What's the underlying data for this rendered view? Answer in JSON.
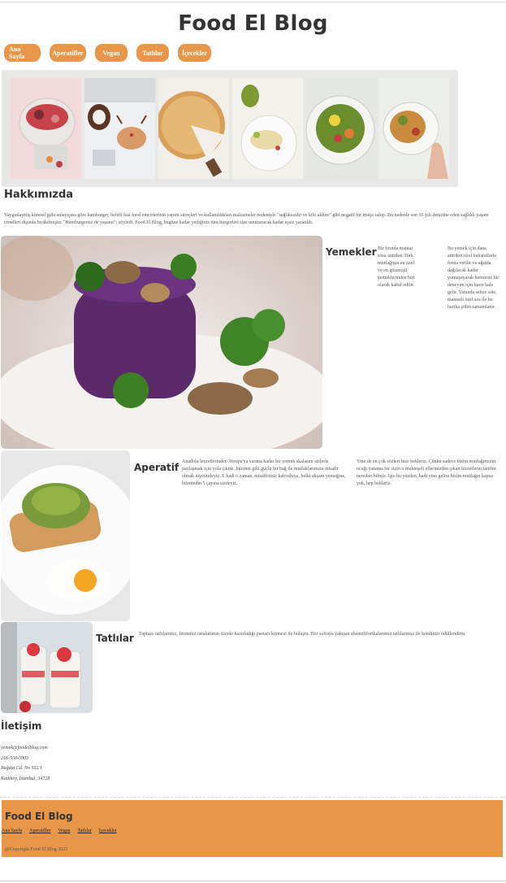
{
  "site_title": "Food El Blog",
  "nav": [
    "Ana Sayfa",
    "Aperatifler",
    "Vegan",
    "Tatlılar",
    "İçecekler"
  ],
  "about": {
    "title": "Hakkımızda",
    "text": "Yaygınlaşmış küresel gıda anlayışına göre hamburger, belirli fast food zincirlerinin yapım süreçleri ve kullanıldıkları malzemeler nedeniyle \"sağlıksızdır ve kilo aldırır\" gibi negatif bir imaja sahip. Bu nedenle son 10 yılı denizine eden sağlıklı yaşam trendleri dışında bırakılmıştır. \"Hamburgersiz de yaşanır\"; söyledi. Food El Blog, bugüne kadar yediğiniz tüm burgerleri size unutturacak kadar eşsiz yaratıldı."
  },
  "sections": [
    {
      "title": "Yemekler",
      "col1": "Bir fırında mantar sosu antrikot Türk mutfağının en özel ve en gösterişli yemeklerinden biri olarak kabul edilir.",
      "col2": "Bu yemek için dana antrikot özel baharatlarla fırına verilir ve ağızda dağılacak kadar yumuşayarak hemresiz bir deneyim için hazır hale gelir. Yanında sebze sote, mantarlı özel sos ile bu harika şölen tamamlanır."
    },
    {
      "title": "Aperatif",
      "col1": "Anadolu lezzetlerinden Avrupa'ya varana kadar bir yemek skalasını sizlerle paylaşmak için yola çıktık. İnternet gibi güçlü bir bağ ile mutfaklarımıza misafir olmak niyetindeyiz. E hadi o zaman, misafirimiz kahvaltıya, belki akşam yemeğine, bilemedin 5 çayına sizdeyiz.",
      "col2": "Yine de en çok sözleri bize bekleriz. Çünkü sadece bizim mutfağımızın ocağı yanarsa bir sizin o muhteşeli ellerinizden çıkan lezzetlerin tarifini nereden bilmiz. İşte bu yüzden, hadi yine gelirz bizim mutfağın kapısı yok, hep bekleriz."
    },
    {
      "title": "Tatlılar",
      "col1": "Taptaze tatlılarımız, fırınımız ustalarımın özenle hazırladığı pastacı kremesi ile buluştu. Her sofraya yakışan ahenetlifortkalarımız tatlılarımız ile kendinizi ödüllendirin."
    }
  ],
  "contact": {
    "title": "İletişim",
    "lines": [
      "yemek@foodelblog.com",
      "216-550-5903",
      "Bağdat Cd. No 502/1",
      "Kadıköy, İstanbul, 34728"
    ]
  },
  "footer": {
    "title": "Food El Blog",
    "links": [
      "Ana Sayfa",
      "Aperatifler",
      "Vegan",
      "Tatlılar",
      "İçecekler"
    ],
    "copyright": "@Copyright Food El Blog 2022"
  },
  "colors": {
    "accent": "#e8974a",
    "gallery_bg": "#e7e7e5"
  }
}
